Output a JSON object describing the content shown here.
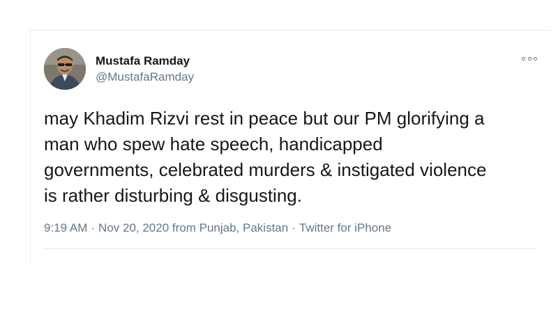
{
  "user": {
    "display_name": "Mustafa Ramday",
    "handle": "@MustafaRamday",
    "avatar_icon": "profile-photo"
  },
  "tweet": {
    "lines": [
      "may Khadim Rizvi rest in peace but our PM glorifying a",
      "man who spew hate speech, handicapped",
      "governments, celebrated murders & instigated violence",
      "is rather disturbing & disgusting."
    ]
  },
  "meta": {
    "time": "9:19 AM",
    "date_location": "Nov 20, 2020 from Punjab, Pakistan",
    "source": "Twitter for iPhone",
    "separator": "·"
  },
  "menu": {
    "icon": "more-options-icon"
  },
  "colors": {
    "text": "#14171a",
    "secondary": "#657786",
    "border": "#e6ecf0"
  }
}
